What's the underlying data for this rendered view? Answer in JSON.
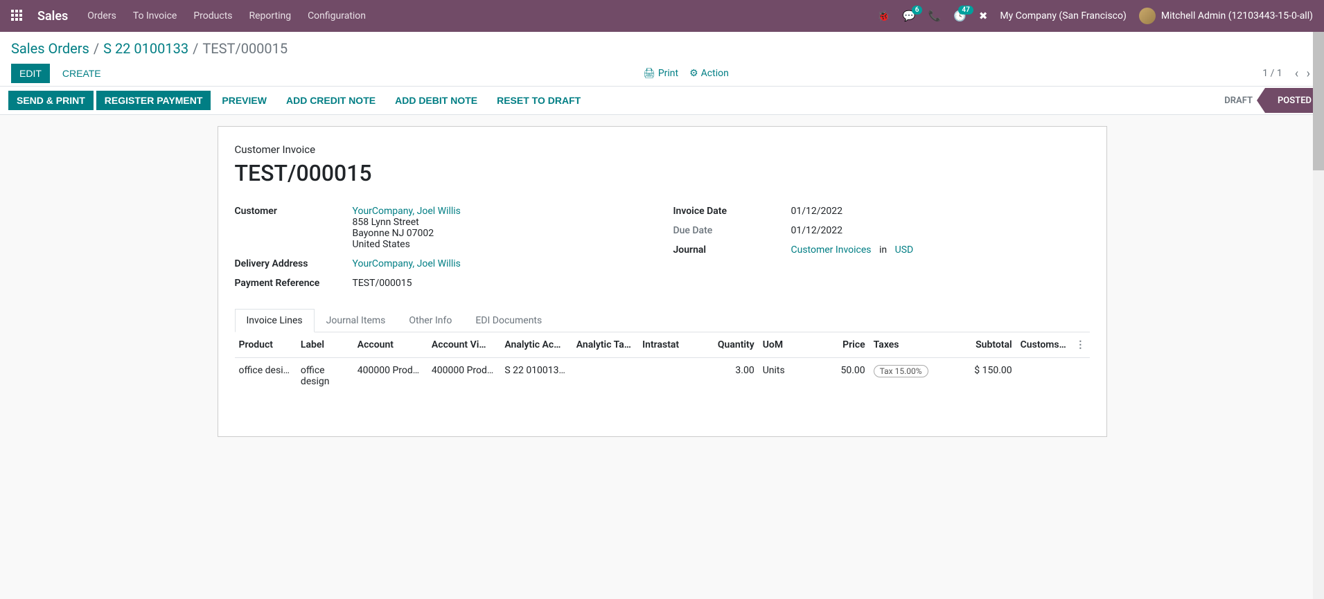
{
  "navbar": {
    "brand": "Sales",
    "menu": [
      "Orders",
      "To Invoice",
      "Products",
      "Reporting",
      "Configuration"
    ],
    "badges": {
      "messages": "6",
      "activities": "47"
    },
    "company": "My Company (San Francisco)",
    "user": "Mitchell Admin (12103443-15-0-all)"
  },
  "breadcrumb": {
    "root": "Sales Orders",
    "order": "S 22 0100133",
    "current": "TEST/000015"
  },
  "cp": {
    "edit": "EDIT",
    "create": "CREATE",
    "print": "Print",
    "action": "Action",
    "pager": "1 / 1"
  },
  "statusbar": {
    "buttons": [
      "SEND & PRINT",
      "REGISTER PAYMENT",
      "PREVIEW",
      "ADD CREDIT NOTE",
      "ADD DEBIT NOTE",
      "RESET TO DRAFT"
    ],
    "stages": {
      "draft": "DRAFT",
      "posted": "POSTED"
    }
  },
  "sheet": {
    "type_label": "Customer Invoice",
    "title": "TEST/000015",
    "left": {
      "customer_label": "Customer",
      "customer_link": "YourCompany, Joel Willis",
      "addr1": "858 Lynn Street",
      "addr2": "Bayonne NJ 07002",
      "addr3": "United States",
      "delivery_label": "Delivery Address",
      "delivery_link": "YourCompany, Joel Willis",
      "payref_label": "Payment Reference",
      "payref": "TEST/000015"
    },
    "right": {
      "invdate_label": "Invoice Date",
      "invdate": "01/12/2022",
      "duedate_label": "Due Date",
      "duedate": "01/12/2022",
      "journal_label": "Journal",
      "journal_link": "Customer Invoices",
      "in": "in",
      "currency": "USD"
    }
  },
  "tabs": [
    "Invoice Lines",
    "Journal Items",
    "Other Info",
    "EDI Documents"
  ],
  "table": {
    "headers": {
      "product": "Product",
      "label": "Label",
      "account": "Account",
      "account_view": "Account Vi…",
      "analytic_acc": "Analytic Ac…",
      "analytic_tag": "Analytic Ta…",
      "intrastat": "Intrastat",
      "quantity": "Quantity",
      "uom": "UoM",
      "price": "Price",
      "taxes": "Taxes",
      "subtotal": "Subtotal",
      "customs": "Customs…"
    },
    "rows": [
      {
        "product": "office desi…",
        "label": "office design",
        "account": "400000 Prod…",
        "account_view": "400000 Prod…",
        "analytic_acc": "S 22 010013…",
        "analytic_tag": "",
        "intrastat": "",
        "quantity": "3.00",
        "uom": "Units",
        "price": "50.00",
        "taxes": "Tax 15.00%",
        "subtotal": "$ 150.00",
        "customs": ""
      }
    ]
  }
}
